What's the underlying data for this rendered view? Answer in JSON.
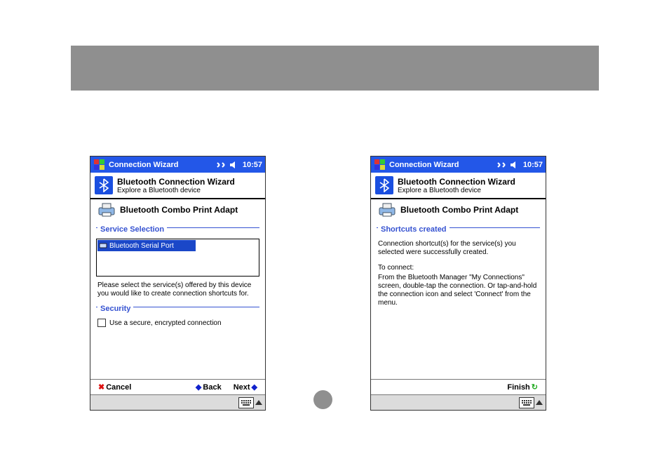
{
  "titlebar": {
    "app": "Connection Wizard",
    "time": "10:57"
  },
  "header": {
    "title": "Bluetooth Connection Wizard",
    "sub": "Explore a Bluetooth device"
  },
  "printer": {
    "name": "Bluetooth Combo Print Adapt"
  },
  "left": {
    "section_service": "Service Selection",
    "service_item": "Bluetooth Serial Port",
    "hint": "Please select the service(s) offered by this device you would like to create connection shortcuts for.",
    "section_security": "Security",
    "sec_label": "Use a secure, encrypted connection",
    "cmd_cancel": "Cancel",
    "cmd_back": "Back",
    "cmd_next": "Next"
  },
  "right": {
    "section": "Shortcuts created",
    "msg1": "Connection shortcut(s)  for the service(s) you selected were successfully created.",
    "msg2": "To connect:",
    "msg3": "From the Bluetooth Manager \"My Connections\" screen, double-tap the connection. Or tap-and-hold the connection icon and select 'Connect' from the menu.",
    "cmd_finish": "Finish"
  }
}
